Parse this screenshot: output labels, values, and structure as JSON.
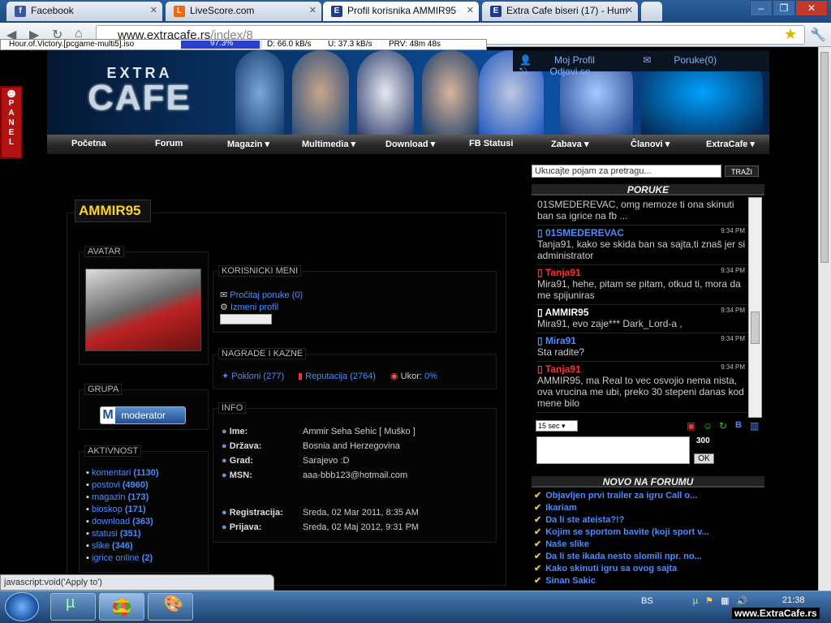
{
  "browser": {
    "tabs": [
      {
        "label": "Facebook",
        "icon": "facebook-icon"
      },
      {
        "label": "LiveScore.com",
        "icon": "livescore-icon"
      },
      {
        "label": "Profil korisnika AMMIR95",
        "icon": "extracafe-icon"
      },
      {
        "label": "Extra Cafe biseri (17) - Hum",
        "icon": "extracafe-icon"
      }
    ],
    "url_domain": "www.extracafe.rs",
    "url_path": "/index/8",
    "status_text": "javascript:void('Apply to')"
  },
  "download_bar": {
    "file": "Hour.of.Victory.[pcgame-multi5].iso",
    "progress_label": "97.3%",
    "progress": 0.973,
    "download_speed": "D: 66.0 kB/s",
    "upload_speed": "U: 37.3 kB/s",
    "priority": "PRV: 48m 48s"
  },
  "site": {
    "side_panel_label": "PANEL",
    "logo_top": "EXTRA",
    "logo_bottom": "CAFE",
    "top_links": [
      "Moj Profil",
      "Poruke(0)",
      "Odjavi se"
    ],
    "menu": [
      {
        "label": "Početna",
        "dropdown": false
      },
      {
        "label": "Forum",
        "dropdown": false
      },
      {
        "label": "Magazin",
        "dropdown": true
      },
      {
        "label": "Multimedia",
        "dropdown": true
      },
      {
        "label": "Download",
        "dropdown": true
      },
      {
        "label": "FB Statusi",
        "dropdown": false
      },
      {
        "label": "Zabava",
        "dropdown": true
      },
      {
        "label": "Članovi",
        "dropdown": true
      },
      {
        "label": "ExtraCafe",
        "dropdown": true
      }
    ],
    "search_placeholder": "Ukucajte pojam za pretragu...",
    "search_button": "TRAŽI"
  },
  "profile": {
    "username": "AMMIR95",
    "avatar_title": "AVATAR",
    "group_title": "GRUPA",
    "group_badge": "moderator",
    "activity_title": "AKTIVNOST",
    "activity": [
      {
        "label": "komentari",
        "count": "(1130)"
      },
      {
        "label": "postovi",
        "count": "(4960)"
      },
      {
        "label": "magazin",
        "count": "(173)"
      },
      {
        "label": "bioskop",
        "count": "(171)"
      },
      {
        "label": "download",
        "count": "(363)"
      },
      {
        "label": "statusi",
        "count": "(351)"
      },
      {
        "label": "slike",
        "count": "(346)"
      },
      {
        "label": "igrice online",
        "count": "(2)"
      }
    ],
    "menu_title": "KORISNICKI MENI",
    "menu_links": [
      "Pročitaj poruke (0)",
      "Izmeni profil"
    ],
    "awards_title": "NAGRADE I KAZNE",
    "awards": [
      {
        "label": "Pokloni",
        "count": "(277)"
      },
      {
        "label": "Reputacija",
        "count": "(2764)"
      },
      {
        "label": "Ukor:",
        "count": "0%"
      }
    ],
    "info_title": "INFO",
    "info": [
      {
        "label": "Ime:",
        "value": "Ammir Seha Sehic [ Muško ]"
      },
      {
        "label": "Država:",
        "value": "Bosnia and Herzegovina"
      },
      {
        "label": "Grad:",
        "value": "Sarajevo :D"
      },
      {
        "label": "MSN:",
        "value": "aaa-bbb123@hotmail.com"
      },
      {
        "label": "Registracija:",
        "value": "Sreda, 02 Mar 2011, 8:35 AM"
      },
      {
        "label": "Prijava:",
        "value": "Sreda, 02 Maj 2012, 9:31 PM"
      }
    ]
  },
  "shoutbox": {
    "title": "PORUKE",
    "messages": [
      {
        "user": "",
        "time": "",
        "text": "01SMEDEREVAC, omg nemoze ti ona skinuti ban sa igrice na fb ...",
        "color": "#cccccc"
      },
      {
        "user": "01SMEDEREVAC",
        "time": "9:34 PM",
        "text": "Tanja91, kako se skida ban sa sajta,ti znaš jer si administrator",
        "color": "#4a8cff"
      },
      {
        "user": "Tanja91",
        "time": "9:34 PM",
        "text": "Mira91, hehe, pitam se pitam, otkud ti, mora da me spijuniras",
        "color": "#ff3030"
      },
      {
        "user": "AMMIR95",
        "time": "9:34 PM",
        "text": "Mira91, evo zaje*** Dark_Lord-a ,",
        "color": "#ffffff"
      },
      {
        "user": "Mira91",
        "time": "9:34 PM",
        "text": "Sta radite?",
        "color": "#4a8cff"
      },
      {
        "user": "Tanja91",
        "time": "9:34 PM",
        "text": "AMMIR95, ma Real to vec osvojio nema nista, ova vrucina me ubi, preko 30 stepeni danas kod mene bilo",
        "color": "#ff3030"
      }
    ],
    "refresh_select": "15 sec",
    "char_count": "300",
    "ok_button": "OK"
  },
  "forum": {
    "title": "NOVO NA FORUMU",
    "items": [
      "Objavljen prvi trailer za igru Call o...",
      "Ikariam",
      "Da li ste ateista?!?",
      "Kojim se sportom bavite (koji sport v...",
      "Naše slike",
      "Da li ste ikada nesto slomili npr. no...",
      "Kako skinuti igru sa ovog sajta",
      "Sinan Sakic"
    ]
  },
  "taskbar": {
    "language": "BS",
    "time": "21:38",
    "watermark": "www.ExtraCafe.rs"
  },
  "colors": {
    "accent": "#4a8cff",
    "username": "#ffd324",
    "menu_bg": "#2a2a2a"
  }
}
